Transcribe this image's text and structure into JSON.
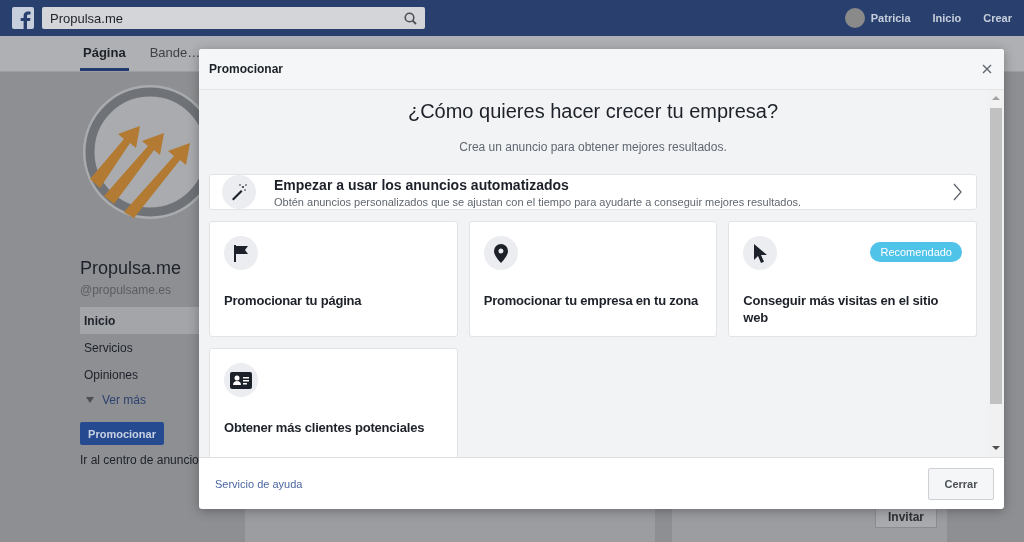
{
  "topbar": {
    "search": {
      "value": "Propulsa.me"
    },
    "user": "Patricia",
    "nav": [
      "Inicio",
      "Crear"
    ]
  },
  "page_tabs": [
    {
      "label": "Página",
      "selected": true
    },
    {
      "label": "Bande…",
      "selected": false
    }
  ],
  "page": {
    "name": "Propulsa.me",
    "handle": "@propulsame.es",
    "menu": [
      {
        "label": "Inicio",
        "selected": true
      },
      {
        "label": "Servicios",
        "selected": false
      },
      {
        "label": "Opiniones",
        "selected": false
      }
    ],
    "more": "Ver más",
    "promote_button": "Promocionar",
    "ads_center_link": "Ir al centro de anuncio",
    "invite_button": "Invitar"
  },
  "modal": {
    "title": "Promocionar",
    "heading": "¿Cómo quieres hacer crecer tu empresa?",
    "subtitle": "Crea un anuncio para obtener mejores resultados.",
    "featured": {
      "title": "Empezar a usar los anuncios automatizados",
      "description": "Obtén anuncios personalizados que se ajustan con el tiempo para ayudarte a conseguir mejores resultados."
    },
    "options": [
      {
        "kind": "flag",
        "title": "Promocionar tu página"
      },
      {
        "kind": "pin",
        "title": "Promocionar tu empresa en tu zona"
      },
      {
        "kind": "cursor",
        "title": "Conseguir más visitas en el sitio web",
        "badge": "Recomendado"
      },
      {
        "kind": "contact",
        "title": "Obtener más clientes potenciales"
      }
    ],
    "help_link": "Servicio de ayuda",
    "close_button": "Cerrar"
  }
}
